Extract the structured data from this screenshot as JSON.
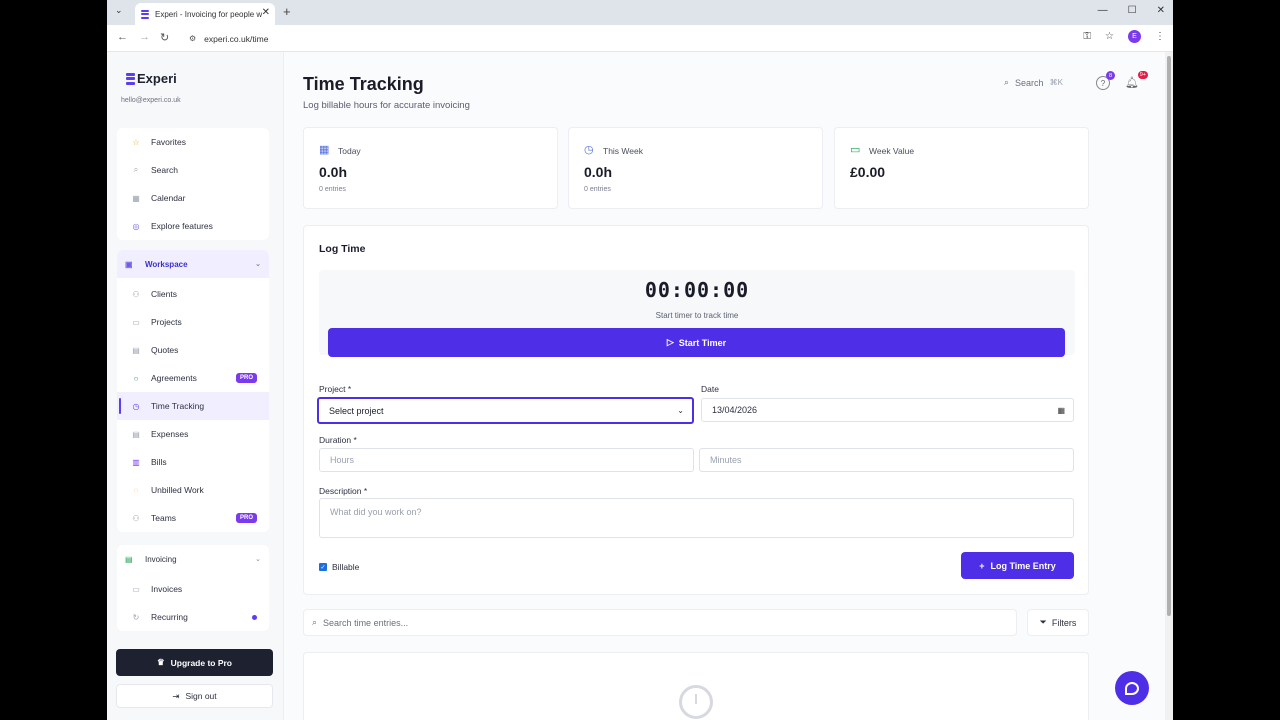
{
  "browser": {
    "tab_title": "Experi - Invoicing for people w",
    "url": "experi.co.uk/time",
    "profile_initial": "E"
  },
  "brand": {
    "name": "Experi",
    "email": "hello@experi.co.uk"
  },
  "sidebar": {
    "quick": [
      {
        "label": "Favorites",
        "icon": "star-icon"
      },
      {
        "label": "Search",
        "icon": "search-icon"
      },
      {
        "label": "Calendar",
        "icon": "calendar-icon"
      },
      {
        "label": "Explore features",
        "icon": "compass-icon"
      }
    ],
    "workspace_label": "Workspace",
    "workspace": [
      {
        "label": "Clients",
        "icon": "users-icon"
      },
      {
        "label": "Projects",
        "icon": "folder-icon"
      },
      {
        "label": "Quotes",
        "icon": "document-icon"
      },
      {
        "label": "Agreements",
        "icon": "shield-icon",
        "badge": "PRO"
      },
      {
        "label": "Time Tracking",
        "icon": "clock-icon",
        "active": true
      },
      {
        "label": "Expenses",
        "icon": "receipt-icon"
      },
      {
        "label": "Bills",
        "icon": "bill-icon"
      },
      {
        "label": "Unbilled Work",
        "icon": "alert-icon"
      },
      {
        "label": "Teams",
        "icon": "team-icon",
        "badge": "PRO"
      }
    ],
    "invoicing_label": "Invoicing",
    "invoicing": [
      {
        "label": "Invoices",
        "icon": "invoice-icon"
      },
      {
        "label": "Recurring",
        "icon": "repeat-icon"
      }
    ],
    "upgrade_label": "Upgrade to Pro",
    "signout_label": "Sign out"
  },
  "header": {
    "title": "Time Tracking",
    "subtitle": "Log billable hours for accurate invoicing",
    "search_label": "Search",
    "search_shortcut": "⌘K",
    "help_badge": "8",
    "notif_badge": "9+"
  },
  "stats": [
    {
      "label": "Today",
      "value": "0.0h",
      "sub": "0 entries",
      "icon": "calendar-icon",
      "color": "#4f6bdc"
    },
    {
      "label": "This Week",
      "value": "0.0h",
      "sub": "0 entries",
      "icon": "clock-icon",
      "color": "#4f6bdc"
    },
    {
      "label": "Week Value",
      "value": "£0.00",
      "sub": "",
      "icon": "money-icon",
      "color": "#16a34a"
    }
  ],
  "log": {
    "title": "Log Time",
    "timer": "00:00:00",
    "timer_hint": "Start timer to track time",
    "start_label": "Start Timer",
    "project_label": "Project *",
    "project_value": "Select project",
    "date_label": "Date",
    "date_value": "13/04/2026",
    "duration_label": "Duration *",
    "hours_placeholder": "Hours",
    "minutes_placeholder": "Minutes",
    "description_label": "Description *",
    "description_placeholder": "What did you work on?",
    "billable_label": "Billable",
    "billable_checked": true,
    "submit_label": "Log Time Entry"
  },
  "entries": {
    "search_placeholder": "Search time entries...",
    "filters_label": "Filters"
  },
  "colors": {
    "accent": "#4f2ee8",
    "pro": "#7c3aed"
  }
}
